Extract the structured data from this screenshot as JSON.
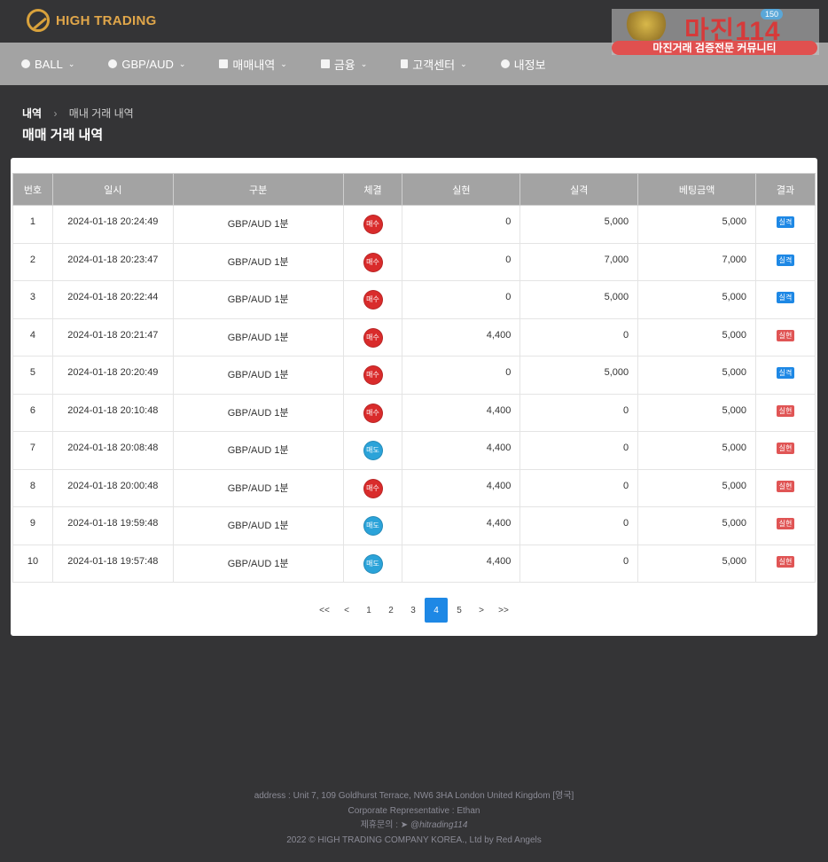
{
  "brand": {
    "name": "HIGH TRADING",
    "color": "#e0a64a"
  },
  "watermark": {
    "title": "마진114",
    "badge": "150",
    "subtitle": "마진거래 검증전문 커뮤니티"
  },
  "nav": [
    {
      "label": "BALL",
      "icon": "ball-icon",
      "caret": "⌄"
    },
    {
      "label": "GBP/AUD",
      "icon": "coin-icon",
      "caret": "⌄"
    },
    {
      "label": "매매내역",
      "icon": "chart-icon",
      "caret": "⌄"
    },
    {
      "label": "금융",
      "icon": "chart-icon",
      "caret": "⌄"
    },
    {
      "label": "고객센터",
      "icon": "document-icon",
      "caret": "⌄"
    },
    {
      "label": "내정보",
      "icon": "user-icon",
      "caret": ""
    }
  ],
  "breadcrumb": {
    "home": "내역",
    "separator": "›",
    "current": "매내 거래 내역"
  },
  "page_title": "매매 거래 내역",
  "table": {
    "headers": [
      "번호",
      "일시",
      "구분",
      "체결",
      "실현",
      "실격",
      "베팅금액",
      "결과"
    ],
    "rows": [
      {
        "no": "1",
        "time": "2024-01-18 20:24:49",
        "type": "GBP/AUD 1분",
        "trade": "매수",
        "realized": "0",
        "lost": "5,000",
        "bet": "5,000",
        "result": "실격"
      },
      {
        "no": "2",
        "time": "2024-01-18 20:23:47",
        "type": "GBP/AUD 1분",
        "trade": "매수",
        "realized": "0",
        "lost": "7,000",
        "bet": "7,000",
        "result": "실격"
      },
      {
        "no": "3",
        "time": "2024-01-18 20:22:44",
        "type": "GBP/AUD 1분",
        "trade": "매수",
        "realized": "0",
        "lost": "5,000",
        "bet": "5,000",
        "result": "실격"
      },
      {
        "no": "4",
        "time": "2024-01-18 20:21:47",
        "type": "GBP/AUD 1분",
        "trade": "매수",
        "realized": "4,400",
        "lost": "0",
        "bet": "5,000",
        "result": "실현"
      },
      {
        "no": "5",
        "time": "2024-01-18 20:20:49",
        "type": "GBP/AUD 1분",
        "trade": "매수",
        "realized": "0",
        "lost": "5,000",
        "bet": "5,000",
        "result": "실격"
      },
      {
        "no": "6",
        "time": "2024-01-18 20:10:48",
        "type": "GBP/AUD 1분",
        "trade": "매수",
        "realized": "4,400",
        "lost": "0",
        "bet": "5,000",
        "result": "실현"
      },
      {
        "no": "7",
        "time": "2024-01-18 20:08:48",
        "type": "GBP/AUD 1분",
        "trade": "매도",
        "realized": "4,400",
        "lost": "0",
        "bet": "5,000",
        "result": "실현"
      },
      {
        "no": "8",
        "time": "2024-01-18 20:00:48",
        "type": "GBP/AUD 1분",
        "trade": "매수",
        "realized": "4,400",
        "lost": "0",
        "bet": "5,000",
        "result": "실현"
      },
      {
        "no": "9",
        "time": "2024-01-18 19:59:48",
        "type": "GBP/AUD 1분",
        "trade": "매도",
        "realized": "4,400",
        "lost": "0",
        "bet": "5,000",
        "result": "실현"
      },
      {
        "no": "10",
        "time": "2024-01-18 19:57:48",
        "type": "GBP/AUD 1분",
        "trade": "매도",
        "realized": "4,400",
        "lost": "0",
        "bet": "5,000",
        "result": "실현"
      }
    ]
  },
  "colors": {
    "buy": "#d92b2b",
    "sell": "#2ba3d9",
    "lost_tag": "#1e88e5",
    "realized_tag": "#e05555",
    "active_page": "#1e88e5"
  },
  "pagination": {
    "items": [
      "<<",
      "<",
      "1",
      "2",
      "3",
      "4",
      "5",
      ">",
      ">>"
    ],
    "active": "4"
  },
  "footer": {
    "address": "address : Unit 7, 109 Goldhurst Terrace, NW6 3HA London United Kingdom [영국]",
    "representative": "Corporate Representative : Ethan",
    "contact_label": "제휴문의 : ",
    "contact_handle": "@hitrading114",
    "copyright": "2022 © HIGH TRADING COMPANY KOREA., Ltd by Red Angels"
  }
}
